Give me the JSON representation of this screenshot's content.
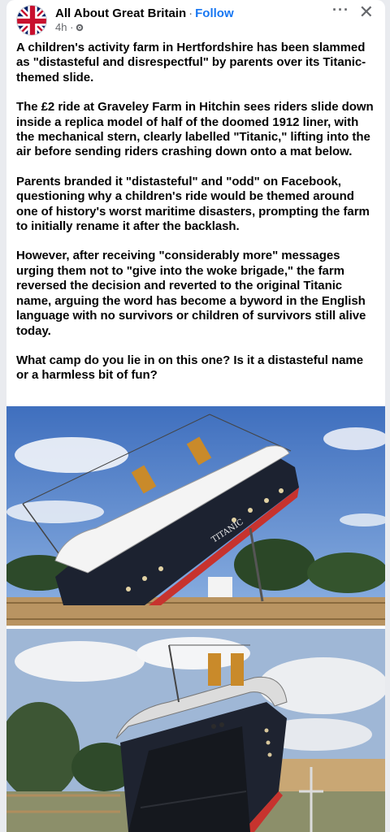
{
  "post": {
    "page_name": "All About Great Britain",
    "separator": "·",
    "follow_label": "Follow",
    "time": "4h ·",
    "audience_icon": "gear-icon",
    "more_icon": "···",
    "close_icon": "✕",
    "paragraphs": [
      "A children's activity farm in Hertfordshire has been slammed as \"distasteful and disrespectful\" by parents over its Titanic-themed slide.",
      "The £2 ride at Graveley Farm in Hitchin sees riders slide down inside a replica model of half of the doomed 1912 liner, with the mechanical stern, clearly labelled \"Titanic,\" lifting into the air before sending riders crashing down onto a mat below.",
      "Parents branded it \"distasteful\" and \"odd\" on Facebook, questioning why a children's ride would be themed around one of history's worst maritime disasters, prompting the farm to initially rename it after the backlash.",
      "However, after receiving \"considerably more\" messages urging them not to \"give into the woke brigade,\" the farm reversed the decision and reverted to the original Titanic name, arguing the word has become a byword in the English language with no survivors or children of survivors still alive today.",
      "What camp do you lie in on this one? Is it a distasteful name or a harmless bit of fun?"
    ]
  },
  "photos": {
    "photo1_ship_label": "TITANIC"
  },
  "colors": {
    "link": "#1877f2",
    "text": "#050505",
    "secondary": "#65676b",
    "hull": "#1c2230",
    "hull_red": "#c7332e",
    "funnel": "#c98a2a",
    "sky": "#4a79c4"
  }
}
